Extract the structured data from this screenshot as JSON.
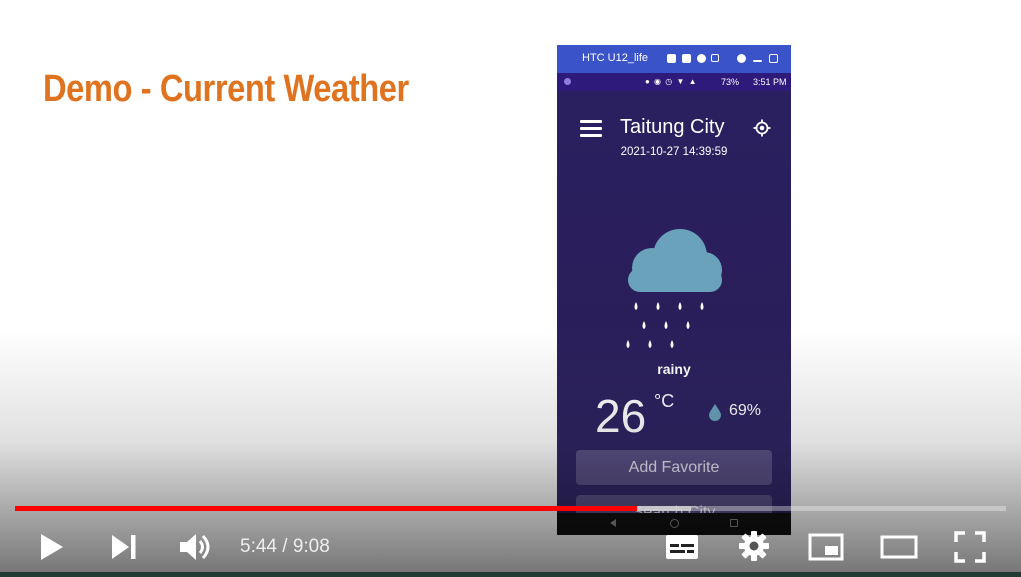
{
  "slide": {
    "title": "Demo - Current Weather"
  },
  "window": {
    "title": "HTC U12_life"
  },
  "status_bar": {
    "battery": "73%",
    "time": "3:51 PM"
  },
  "app": {
    "city": "Taitung City",
    "datetime": "2021-10-27 14:39:59",
    "condition": "rainy",
    "condition_icon": "rain-cloud-icon",
    "temperature": "26",
    "temperature_unit": "°C",
    "humidity": "69%",
    "buttons": {
      "add_favorite": "Add Favorite",
      "search_city": "Search City"
    }
  },
  "player": {
    "current_time": "5:44",
    "duration": "9:08",
    "time_display": "5:44 / 9:08",
    "progress_fraction": 0.628,
    "buffered_fraction": 0.682,
    "accent_color": "#ff0000"
  },
  "colors": {
    "title": "#e0731f",
    "app_background": "#281e55",
    "button": "#5b5187",
    "cloud": "#6aa2bc"
  }
}
